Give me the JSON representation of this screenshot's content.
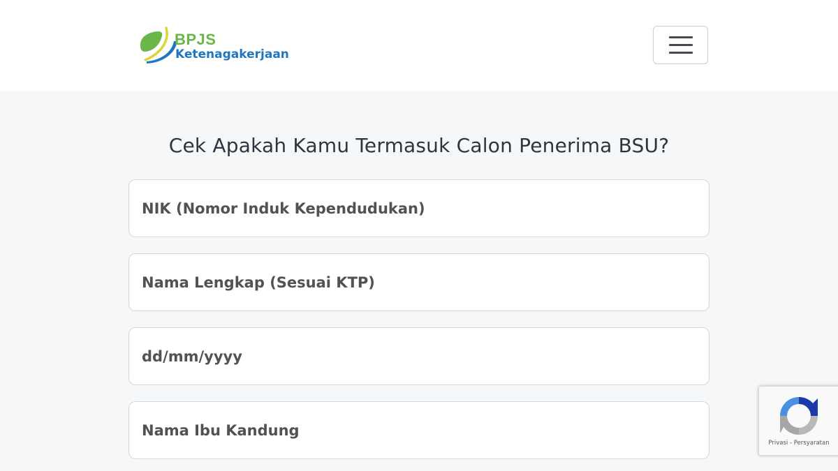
{
  "header": {
    "logo_title": "BPJS",
    "logo_subtitle": "Ketenagakerjaan",
    "menu_icon": "hamburger-menu-icon"
  },
  "page": {
    "title": "Cek Apakah Kamu Termasuk Calon Penerima BSU?"
  },
  "form": {
    "nik": {
      "placeholder": "NIK (Nomor Induk Kependudukan)",
      "value": ""
    },
    "full_name": {
      "placeholder": "Nama Lengkap (Sesuai KTP)",
      "value": ""
    },
    "birth_date": {
      "placeholder": "dd/mm/yyyy",
      "value": ""
    },
    "mother_name": {
      "placeholder": "Nama Ibu Kandung",
      "value": ""
    }
  },
  "recaptcha": {
    "icon": "recaptcha-icon",
    "privacy_label": "Privasi",
    "separator": " - ",
    "terms_label": "Persyaratan"
  },
  "colors": {
    "brand_green": "#6ab648",
    "brand_blue": "#1f76be",
    "brand_yellow": "#d8d63b",
    "page_background": "#f6f7f8",
    "title_text": "#2b3640"
  }
}
